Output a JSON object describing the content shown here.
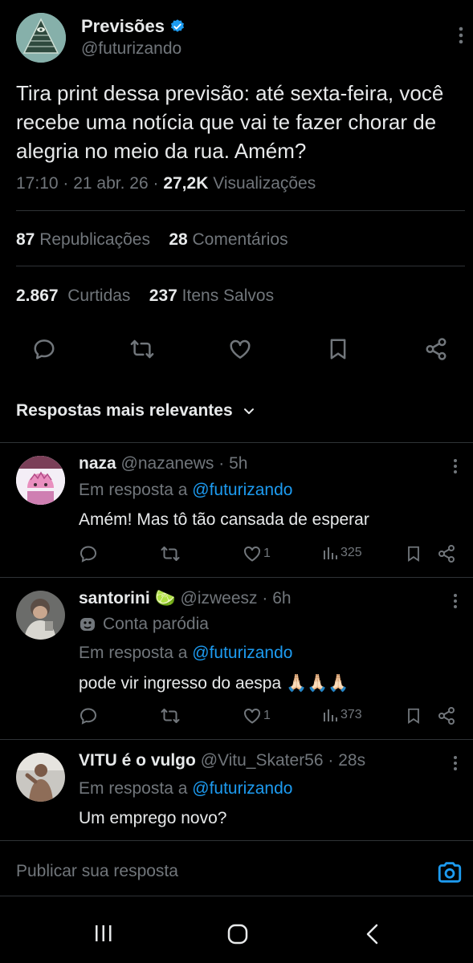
{
  "tweet": {
    "display_name": "Previsões",
    "handle": "@futurizando",
    "text": "Tira print dessa previsão: até sexta-feira, você recebe uma notícia que vai te fazer chorar de alegria no meio da rua. Amém?",
    "time": "17:10",
    "date": "21 abr. 26",
    "views_count": "27,2K",
    "views_label": "Visualizações",
    "reposts_count": "87",
    "reposts_label": "Republicações",
    "comments_count": "28",
    "comments_label": "Comentários",
    "likes_count": "2.867",
    "likes_label": "Curtidas",
    "saves_count": "237",
    "saves_label": "Itens Salvos"
  },
  "sort_label": "Respostas mais relevantes",
  "replies": [
    {
      "name": "naza",
      "handle": "@nazanews",
      "age": "5h",
      "reply_prefix": "Em resposta a",
      "reply_to": "@futurizando",
      "text": "Amém! Mas tô tão cansada de esperar",
      "likes": "1",
      "views": "325"
    },
    {
      "name": "santorini",
      "emoji": "🍋‍🟩",
      "handle": "@izweesz",
      "age": "6h",
      "parody_label": "Conta paródia",
      "reply_prefix": "Em resposta a",
      "reply_to": "@futurizando",
      "text": "pode vir ingresso do aespa",
      "text_emoji": "🙏🏻🙏🏻🙏🏻",
      "likes": "1",
      "views": "373"
    },
    {
      "name": "VITU é o vulgo",
      "handle": "@Vitu_Skater56",
      "age": "28s",
      "reply_prefix": "Em resposta a",
      "reply_to": "@futurizando",
      "text": "Um emprego novo?"
    }
  ],
  "compose_placeholder": "Publicar sua resposta",
  "colors": {
    "background": "#000000",
    "text": "#e7e9ea",
    "muted": "#71767b",
    "accent": "#1d9bf0",
    "divider": "#2f3336"
  }
}
